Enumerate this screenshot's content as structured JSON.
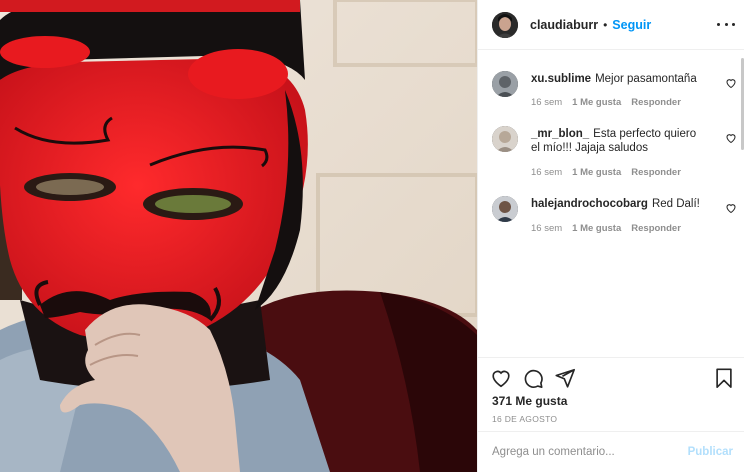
{
  "post": {
    "image_alt": "Persona con pasamontañas rojo"
  },
  "header": {
    "username": "claudiaburr",
    "separator": "•",
    "follow_label": "Seguir",
    "more_icon": "more-horizontal-icon"
  },
  "comments": [
    {
      "username": "xu.sublime",
      "text": "Mejor pasamontaña",
      "time": "16 sem",
      "likes": "1 Me gusta",
      "reply": "Responder"
    },
    {
      "username": "_mr_blon_",
      "text": "Esta perfecto quiero el mío!!! Jajaja saludos",
      "time": "16 sem",
      "likes": "1 Me gusta",
      "reply": "Responder"
    },
    {
      "username": "halejandrochocobarg",
      "text": "Red Dalí!",
      "time": "16 sem",
      "likes": "1 Me gusta",
      "reply": "Responder"
    }
  ],
  "actions": {
    "like_icon": "heart-icon",
    "comment_icon": "comment-icon",
    "share_icon": "share-icon",
    "save_icon": "bookmark-icon",
    "likes_count": "371 Me gusta",
    "date": "16 DE AGOSTO"
  },
  "add_comment": {
    "placeholder": "Agrega un comentario...",
    "publish_label": "Publicar"
  },
  "colors": {
    "accent": "#0095f6",
    "publish_disabled": "#b2dffc",
    "text": "#262626",
    "muted": "#8e8e8e",
    "mask_red": "#e81a1f"
  }
}
